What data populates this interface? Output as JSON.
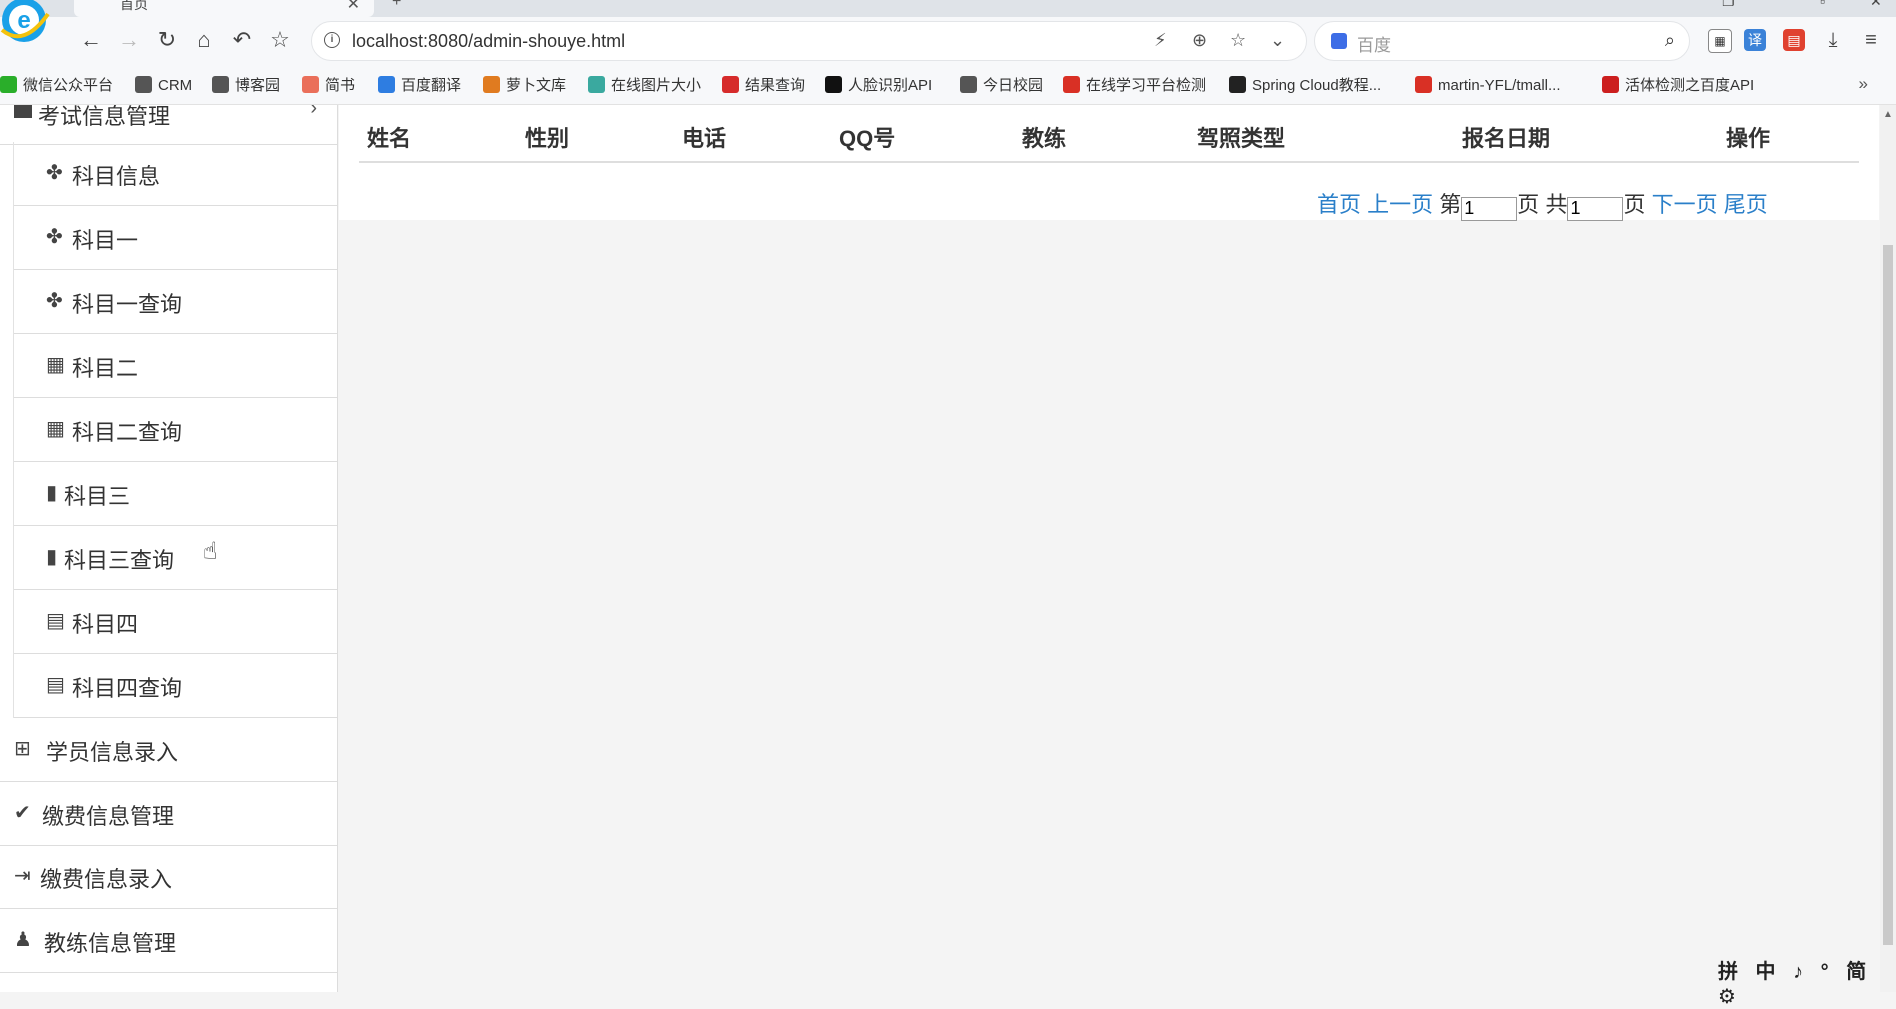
{
  "browser": {
    "tab_title": "首页",
    "url": "localhost:8080/admin-shouye.html",
    "search_placeholder": "百度"
  },
  "bookmarks": [
    {
      "label": "微信公众平台",
      "color": "#2aae2a"
    },
    {
      "label": "CRM",
      "color": "#555555"
    },
    {
      "label": "博客园",
      "color": "#555555"
    },
    {
      "label": "简书",
      "color": "#ea6f5a"
    },
    {
      "label": "百度翻译",
      "color": "#2e7de1"
    },
    {
      "label": "萝卜文库",
      "color": "#e07b20"
    },
    {
      "label": "在线图片大小",
      "color": "#3aa99f"
    },
    {
      "label": "结果查询",
      "color": "#d62b2b"
    },
    {
      "label": "人脸识别API",
      "color": "#111111"
    },
    {
      "label": "今日校园",
      "color": "#555555"
    },
    {
      "label": "在线学习平台检测",
      "color": "#d93025"
    },
    {
      "label": "Spring Cloud教程...",
      "color": "#222222"
    },
    {
      "label": "martin-YFL/tmall...",
      "color": "#d93025"
    },
    {
      "label": "活体检测之百度API",
      "color": "#cc1f1f"
    }
  ],
  "sidebar": {
    "section_label": "考试信息管理",
    "sub_items": [
      {
        "label": "科目信息",
        "icon": "puzzle-icon"
      },
      {
        "label": "科目一",
        "icon": "puzzle-icon"
      },
      {
        "label": "科目一查询",
        "icon": "puzzle-icon"
      },
      {
        "label": "科目二",
        "icon": "grid-icon"
      },
      {
        "label": "科目二查询",
        "icon": "grid-icon"
      },
      {
        "label": "科目三",
        "icon": "bookmark-icon"
      },
      {
        "label": "科目三查询",
        "icon": "bookmark-icon"
      },
      {
        "label": "科目四",
        "icon": "calendar-icon"
      },
      {
        "label": "科目四查询",
        "icon": "calendar-icon"
      }
    ],
    "main_items": [
      {
        "label": "学员信息录入",
        "icon": "table-icon"
      },
      {
        "label": "缴费信息管理",
        "icon": "check-icon"
      },
      {
        "label": "缴费信息录入",
        "icon": "sign-out-icon"
      },
      {
        "label": "教练信息管理",
        "icon": "users-icon"
      }
    ]
  },
  "table": {
    "columns": [
      "姓名",
      "性别",
      "电话",
      "QQ号",
      "教练",
      "驾照类型",
      "报名日期",
      "操作"
    ]
  },
  "pager": {
    "first": "首页",
    "prev": "上一页",
    "page_prefix": "第",
    "page_value": "1",
    "page_suffix": "页",
    "total_prefix": "共",
    "total_value": "1",
    "total_suffix": "页",
    "next": "下一页",
    "last": "尾页"
  },
  "ime_bar": "拼 中 ♪ ° 简 ⚙"
}
